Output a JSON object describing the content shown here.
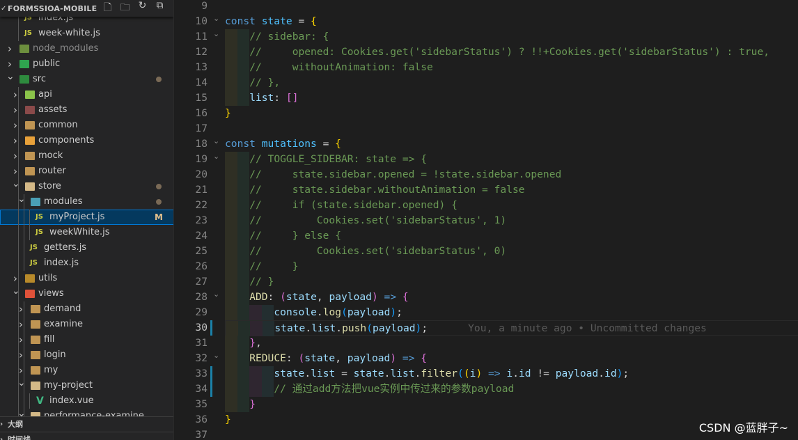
{
  "explorer": {
    "title": "FORMSSIOA-MOBILE",
    "actions": [
      {
        "name": "new-file-icon",
        "glyph": "🗋"
      },
      {
        "name": "new-folder-icon",
        "glyph": "🗀"
      },
      {
        "name": "refresh-icon",
        "glyph": "↻"
      },
      {
        "name": "collapse-all-icon",
        "glyph": "⧉"
      }
    ],
    "items": [
      {
        "label": "index.js",
        "type": "js",
        "level": 1
      },
      {
        "label": "week-white.js",
        "type": "js",
        "level": 1
      },
      {
        "label": "node_modules",
        "type": "folder",
        "level": 0,
        "open": false,
        "color": "#6d8f3e",
        "dim": true
      },
      {
        "label": "public",
        "type": "folder",
        "level": 0,
        "open": false,
        "color": "#2fa44f"
      },
      {
        "label": "src",
        "type": "folder",
        "level": 0,
        "open": true,
        "color": "#2e8b3e",
        "dot": true
      },
      {
        "label": "api",
        "type": "folder",
        "level": 1,
        "open": false,
        "color": "#8bc34a"
      },
      {
        "label": "assets",
        "type": "folder",
        "level": 1,
        "open": false,
        "color": "#8a4a4a"
      },
      {
        "label": "common",
        "type": "folder",
        "level": 1,
        "open": false,
        "color": "#c09553"
      },
      {
        "label": "components",
        "type": "folder",
        "level": 1,
        "open": false,
        "color": "#e8a13a"
      },
      {
        "label": "mock",
        "type": "folder",
        "level": 1,
        "open": false,
        "color": "#c09553"
      },
      {
        "label": "router",
        "type": "folder",
        "level": 1,
        "open": false,
        "color": "#c09553"
      },
      {
        "label": "store",
        "type": "folder",
        "level": 1,
        "open": true,
        "color": "#d4b987",
        "dot": true
      },
      {
        "label": "modules",
        "type": "folder",
        "level": 2,
        "open": true,
        "color": "#4a9fb5",
        "dot": true
      },
      {
        "label": "myProject.js",
        "type": "js",
        "level": 3,
        "selected": true,
        "badge": "M"
      },
      {
        "label": "weekWhite.js",
        "type": "js",
        "level": 3
      },
      {
        "label": "getters.js",
        "type": "js",
        "level": 2
      },
      {
        "label": "index.js",
        "type": "js",
        "level": 2
      },
      {
        "label": "utils",
        "type": "folder",
        "level": 1,
        "open": false,
        "color": "#b88a2a"
      },
      {
        "label": "views",
        "type": "folder",
        "level": 1,
        "open": true,
        "color": "#e0523a"
      },
      {
        "label": "demand",
        "type": "folder",
        "level": 2,
        "open": false,
        "color": "#c09553"
      },
      {
        "label": "examine",
        "type": "folder",
        "level": 2,
        "open": false,
        "color": "#c09553"
      },
      {
        "label": "fill",
        "type": "folder",
        "level": 2,
        "open": false,
        "color": "#c09553"
      },
      {
        "label": "login",
        "type": "folder",
        "level": 2,
        "open": false,
        "color": "#c09553"
      },
      {
        "label": "my",
        "type": "folder",
        "level": 2,
        "open": false,
        "color": "#c09553"
      },
      {
        "label": "my-project",
        "type": "folder",
        "level": 2,
        "open": true,
        "color": "#d4b987"
      },
      {
        "label": "index.vue",
        "type": "vue",
        "level": 3
      },
      {
        "label": "performance-examine",
        "type": "folder",
        "level": 2,
        "open": true,
        "color": "#d4b987"
      }
    ]
  },
  "panels": [
    {
      "label": "大纲"
    },
    {
      "label": "时间线"
    }
  ],
  "editor": {
    "blame": "You, a minute ago • Uncommitted changes",
    "current_line": 30,
    "modified_lines": [
      30,
      33,
      34
    ],
    "folds": [
      10,
      11,
      18,
      19,
      28,
      32
    ],
    "band_colors": [
      "#2f2f24",
      "#232e29",
      "#2f2630",
      "#232e30"
    ],
    "lines": [
      {
        "n": 9,
        "i": 0,
        "t": []
      },
      {
        "n": 10,
        "i": 0,
        "t": [
          [
            "const ",
            "k"
          ],
          [
            "state",
            "v"
          ],
          [
            " = ",
            "o"
          ],
          [
            "{",
            "b1"
          ]
        ]
      },
      {
        "n": 11,
        "i": 4,
        "t": [
          [
            "// sidebar: {",
            "c"
          ]
        ]
      },
      {
        "n": 12,
        "i": 4,
        "t": [
          [
            "//     opened: Cookies.get('sidebarStatus') ? !!+Cookies.get('sidebarStatus') : true,",
            "c"
          ]
        ]
      },
      {
        "n": 13,
        "i": 4,
        "t": [
          [
            "//     withoutAnimation: false",
            "c"
          ]
        ]
      },
      {
        "n": 14,
        "i": 4,
        "t": [
          [
            "// },",
            "c"
          ]
        ]
      },
      {
        "n": 15,
        "i": 4,
        "t": [
          [
            "list",
            "p"
          ],
          [
            ": ",
            "o"
          ],
          [
            "[]",
            "b2"
          ]
        ]
      },
      {
        "n": 16,
        "i": 0,
        "t": [
          [
            "}",
            "b1"
          ]
        ]
      },
      {
        "n": 17,
        "i": 0,
        "t": []
      },
      {
        "n": 18,
        "i": 0,
        "t": [
          [
            "const ",
            "k"
          ],
          [
            "mutations",
            "v"
          ],
          [
            " = ",
            "o"
          ],
          [
            "{",
            "b1"
          ]
        ]
      },
      {
        "n": 19,
        "i": 4,
        "t": [
          [
            "// TOGGLE_SIDEBAR: state => {",
            "c"
          ]
        ]
      },
      {
        "n": 20,
        "i": 4,
        "t": [
          [
            "//     state.sidebar.opened = !state.sidebar.opened",
            "c"
          ]
        ]
      },
      {
        "n": 21,
        "i": 4,
        "t": [
          [
            "//     state.sidebar.withoutAnimation = false",
            "c"
          ]
        ]
      },
      {
        "n": 22,
        "i": 4,
        "t": [
          [
            "//     if (state.sidebar.opened) {",
            "c"
          ]
        ]
      },
      {
        "n": 23,
        "i": 4,
        "t": [
          [
            "//         Cookies.set('sidebarStatus', 1)",
            "c"
          ]
        ]
      },
      {
        "n": 24,
        "i": 4,
        "t": [
          [
            "//     } else {",
            "c"
          ]
        ]
      },
      {
        "n": 25,
        "i": 4,
        "t": [
          [
            "//         Cookies.set('sidebarStatus', 0)",
            "c"
          ]
        ]
      },
      {
        "n": 26,
        "i": 4,
        "t": [
          [
            "//     }",
            "c"
          ]
        ]
      },
      {
        "n": 27,
        "i": 4,
        "t": [
          [
            "// }",
            "c"
          ]
        ]
      },
      {
        "n": 28,
        "i": 4,
        "t": [
          [
            "ADD",
            "f"
          ],
          [
            ": ",
            "o"
          ],
          [
            "(",
            "b2"
          ],
          [
            "state",
            "p"
          ],
          [
            ", ",
            "o"
          ],
          [
            "payload",
            "p"
          ],
          [
            ")",
            "b2"
          ],
          [
            " => ",
            "k"
          ],
          [
            "{",
            "b2"
          ]
        ]
      },
      {
        "n": 29,
        "i": 8,
        "t": [
          [
            "console",
            "p"
          ],
          [
            ".",
            "o"
          ],
          [
            "log",
            "f"
          ],
          [
            "(",
            "b3"
          ],
          [
            "payload",
            "p"
          ],
          [
            ")",
            "b3"
          ],
          [
            ";",
            "o"
          ]
        ]
      },
      {
        "n": 30,
        "i": 8,
        "t": [
          [
            "state",
            "p"
          ],
          [
            ".",
            "o"
          ],
          [
            "list",
            "p"
          ],
          [
            ".",
            "o"
          ],
          [
            "push",
            "f"
          ],
          [
            "(",
            "b3"
          ],
          [
            "payload",
            "p"
          ],
          [
            ")",
            "b3"
          ],
          [
            ";",
            "o"
          ]
        ]
      },
      {
        "n": 31,
        "i": 4,
        "t": [
          [
            "}",
            "b2"
          ],
          [
            ",",
            "o"
          ]
        ]
      },
      {
        "n": 32,
        "i": 4,
        "t": [
          [
            "REDUCE",
            "f"
          ],
          [
            ": ",
            "o"
          ],
          [
            "(",
            "b2"
          ],
          [
            "state",
            "p"
          ],
          [
            ", ",
            "o"
          ],
          [
            "payload",
            "p"
          ],
          [
            ")",
            "b2"
          ],
          [
            " => ",
            "k"
          ],
          [
            "{",
            "b2"
          ]
        ]
      },
      {
        "n": 33,
        "i": 8,
        "t": [
          [
            "state",
            "p"
          ],
          [
            ".",
            "o"
          ],
          [
            "list",
            "p"
          ],
          [
            " = ",
            "o"
          ],
          [
            "state",
            "p"
          ],
          [
            ".",
            "o"
          ],
          [
            "list",
            "p"
          ],
          [
            ".",
            "o"
          ],
          [
            "filter",
            "f"
          ],
          [
            "(",
            "b3"
          ],
          [
            "(",
            "b1"
          ],
          [
            "i",
            "p"
          ],
          [
            ")",
            "b1"
          ],
          [
            " => ",
            "k"
          ],
          [
            "i",
            "p"
          ],
          [
            ".",
            "o"
          ],
          [
            "id",
            "p"
          ],
          [
            " != ",
            "o"
          ],
          [
            "payload",
            "p"
          ],
          [
            ".",
            "o"
          ],
          [
            "id",
            "p"
          ],
          [
            ")",
            "b3"
          ],
          [
            ";",
            "o"
          ]
        ]
      },
      {
        "n": 34,
        "i": 8,
        "t": [
          [
            "// 通过add方法把vue实例中传过来的参数payload",
            "c"
          ]
        ]
      },
      {
        "n": 35,
        "i": 4,
        "t": [
          [
            "}",
            "b2"
          ]
        ]
      },
      {
        "n": 36,
        "i": 0,
        "t": [
          [
            "}",
            "b1"
          ]
        ]
      },
      {
        "n": 37,
        "i": 0,
        "t": []
      }
    ]
  },
  "watermark": "CSDN @蓝胖子~"
}
